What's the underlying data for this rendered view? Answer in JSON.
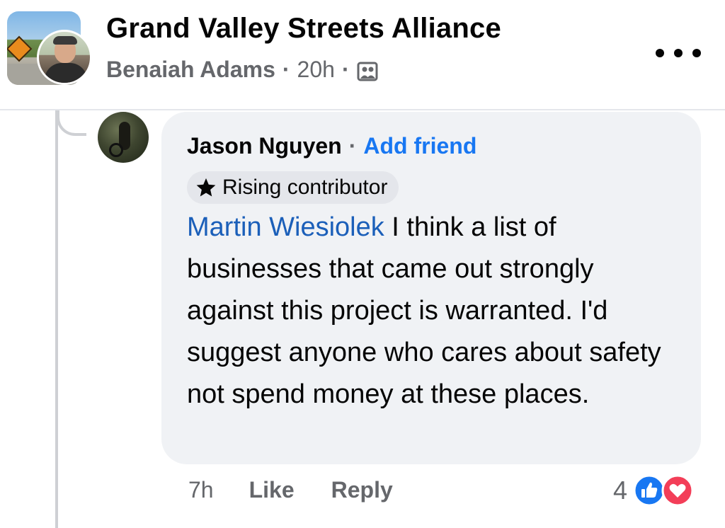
{
  "post": {
    "group_name": "Grand Valley Streets Alliance",
    "author": "Benaiah Adams",
    "separator": "·",
    "time": "20h",
    "privacy_icon": "group-members-icon",
    "more_icon": "more-dots-icon"
  },
  "comment": {
    "author": "Jason Nguyen",
    "separator": "·",
    "add_friend_label": "Add friend",
    "badge_label": "Rising contributor",
    "badge_icon": "star-icon",
    "mention": "Martin Wiesiolek",
    "text": " I think a list of businesses that came out strongly against this project is warranted. I'd suggest anyone who cares about safety not spend money at these places.",
    "time": "7h",
    "like_label": "Like",
    "reply_label": "Reply",
    "reaction_count": "4",
    "reactions": [
      "like-reaction-icon",
      "love-reaction-icon"
    ]
  },
  "colors": {
    "link_blue": "#1877f2",
    "mention_blue": "#1b5fb9",
    "bubble_bg": "#f0f2f5",
    "secondary_text": "#65676b",
    "love_red": "#f33e58"
  }
}
